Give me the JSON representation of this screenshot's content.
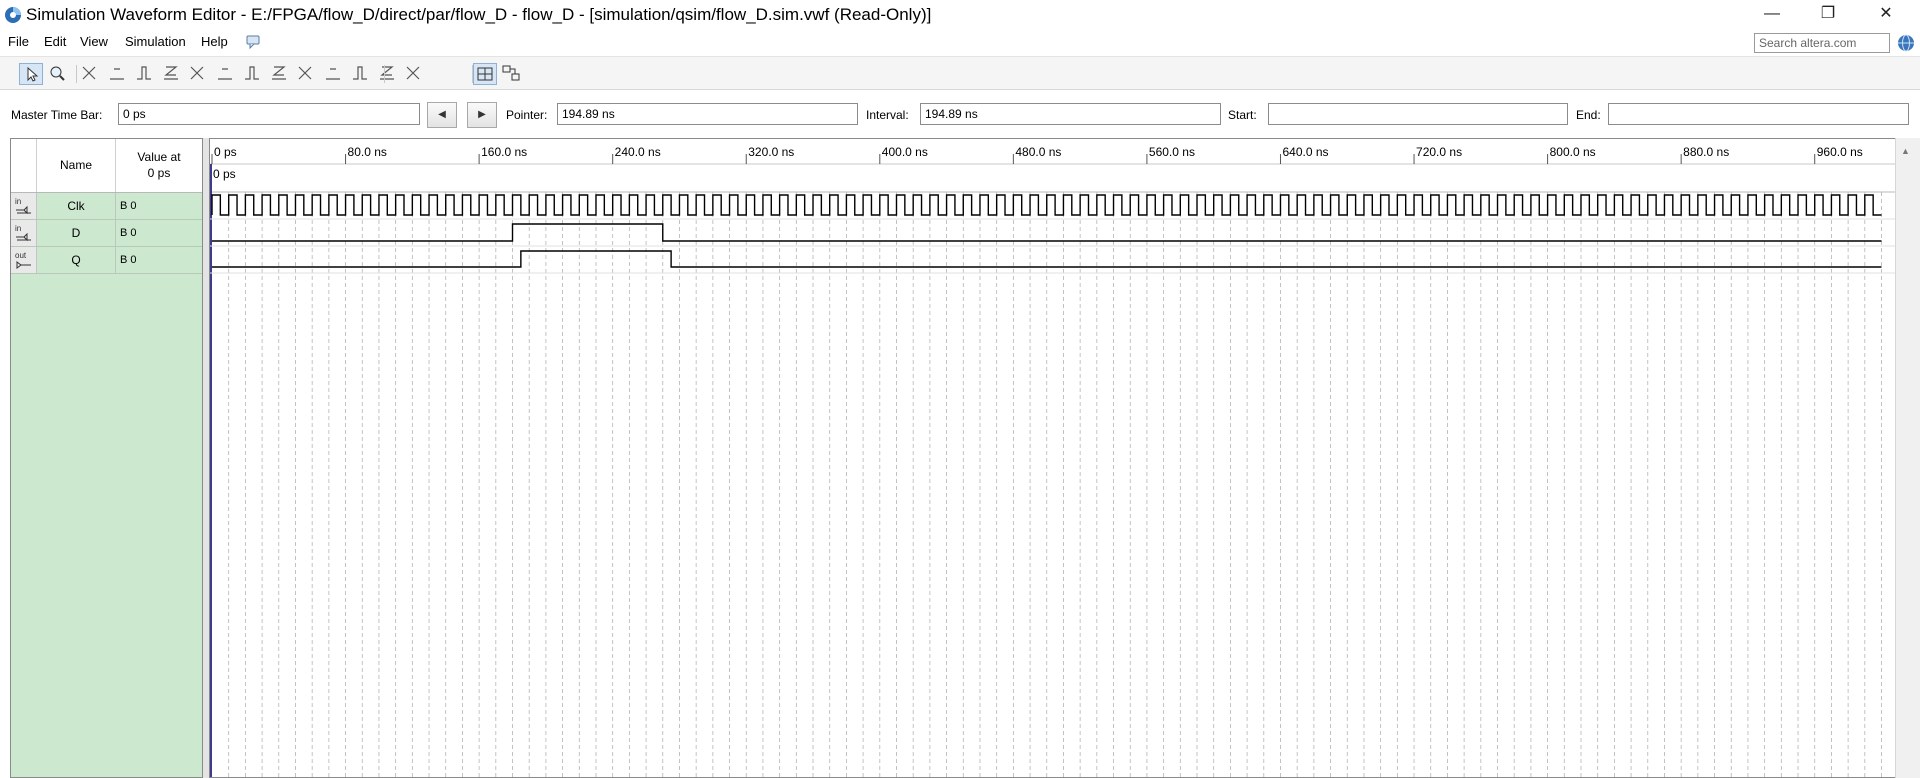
{
  "window": {
    "title": "Simulation Waveform Editor - E:/FPGA/flow_D/direct/par/flow_D - flow_D - [simulation/qsim/flow_D.sim.vwf (Read-Only)]",
    "minimize": "—",
    "restore": "❐",
    "close": "✕"
  },
  "menu": [
    "File",
    "Edit",
    "View",
    "Simulation",
    "Help"
  ],
  "search": {
    "placeholder": "Search altera.com"
  },
  "toolbar": {
    "tools": [
      "selection-tool",
      "zoom-tool",
      "force-unknown",
      "force-low",
      "force-high",
      "force-high-impedance",
      "force-weak-low",
      "force-weak-high",
      "force-dont-care",
      "invert",
      "count-value",
      "overwrite-clock",
      "random-values",
      "snap-to-grid",
      "arbitrary-value",
      "next-transition",
      "previous-transition",
      "snap-transitions",
      "grid-toggle",
      "group-nodes"
    ]
  },
  "timebar": {
    "master_label": "Master Time Bar:",
    "master_value": "0 ps",
    "prev_btn": "◀",
    "next_btn": "▶",
    "pointer_label": "Pointer:",
    "pointer_value": "194.89 ns",
    "interval_label": "Interval:",
    "interval_value": "194.89 ns",
    "start_label": "Start:",
    "start_value": "",
    "end_label": "End:",
    "end_value": ""
  },
  "node_table": {
    "header_name": "Name",
    "header_value_line1": "Value at",
    "header_value_line2": "0 ps",
    "rows": [
      {
        "type": "in",
        "name": "Clk",
        "value": "B 0"
      },
      {
        "type": "in",
        "name": "D",
        "value": "B 0"
      },
      {
        "type": "out",
        "name": "Q",
        "value": "B 0"
      }
    ]
  },
  "waveform": {
    "time_unit": "ns",
    "range_ns": [
      0,
      1000
    ],
    "ticks": [
      "0 ps",
      "80.0 ns",
      "160.0 ns",
      "240.0 ns",
      "320.0 ns",
      "400.0 ns",
      "480.0 ns",
      "560.0 ns",
      "640.0 ns",
      "720.0 ns",
      "800.0 ns",
      "880.0 ns",
      "960.0 ns"
    ],
    "cursor_label": "0 ps",
    "clock_period_ns": 10,
    "signals": {
      "D": {
        "high_from_ns": 180,
        "high_to_ns": 270
      },
      "Q": {
        "high_from_ns": 185,
        "high_to_ns": 275
      }
    }
  },
  "colors": {
    "node_panel": "#cce9d0",
    "grid_line": "#b4b4b4",
    "wave_line": "#000000",
    "cursor": "#3c3c8c"
  }
}
